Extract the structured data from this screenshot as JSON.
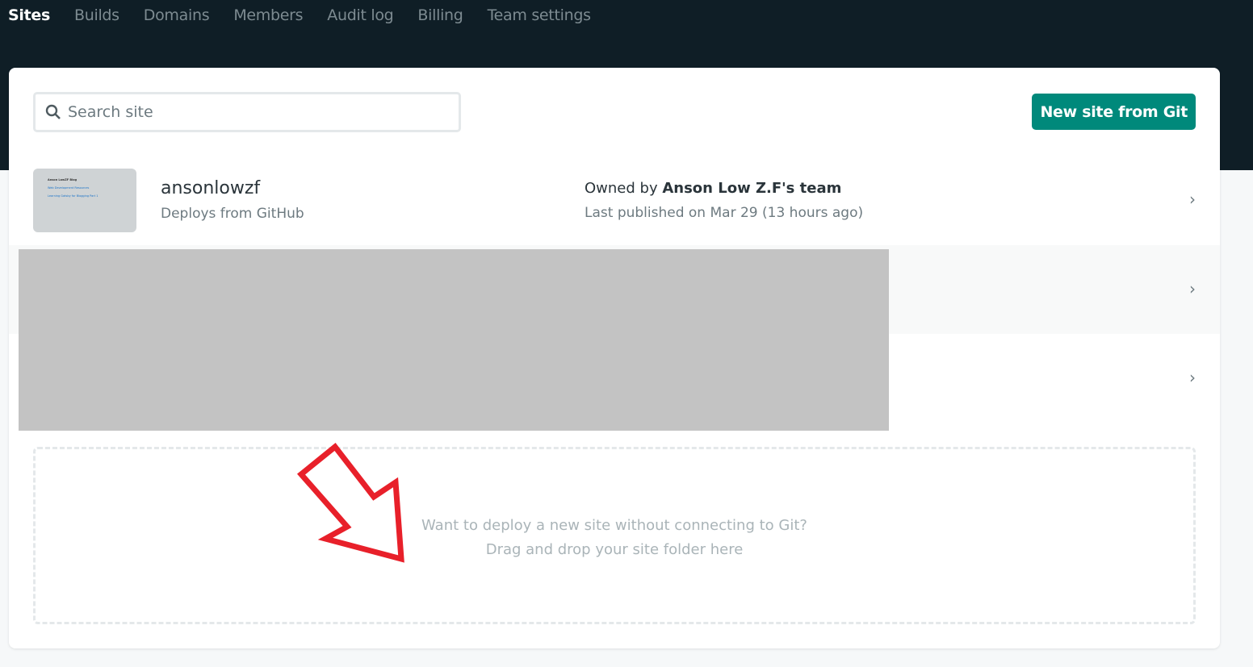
{
  "nav": {
    "items": [
      "Sites",
      "Builds",
      "Domains",
      "Members",
      "Audit log",
      "Billing",
      "Team settings"
    ],
    "active": "Sites"
  },
  "search": {
    "placeholder": "Search site"
  },
  "new_site_button": "New site from Git",
  "sites": [
    {
      "name": "ansonlowzf",
      "source": "Deploys from GitHub",
      "owned_prefix": "Owned by",
      "owner": "Anson Low Z.F's team",
      "published": "Last published on Mar 29 (13 hours ago)",
      "thumbnail": {
        "title": "Anson LowZF Blog",
        "post1": "Web Development Resources",
        "post2": "Learning Gatsby for Blogging Part 1"
      }
    }
  ],
  "dropzone": {
    "line1": "Want to deploy a new site without connecting to Git?",
    "line2": "Drag and drop your site folder here"
  },
  "colors": {
    "header": "#0f1e26",
    "accent": "#00897b",
    "annotation_arrow": "#e8202a"
  }
}
